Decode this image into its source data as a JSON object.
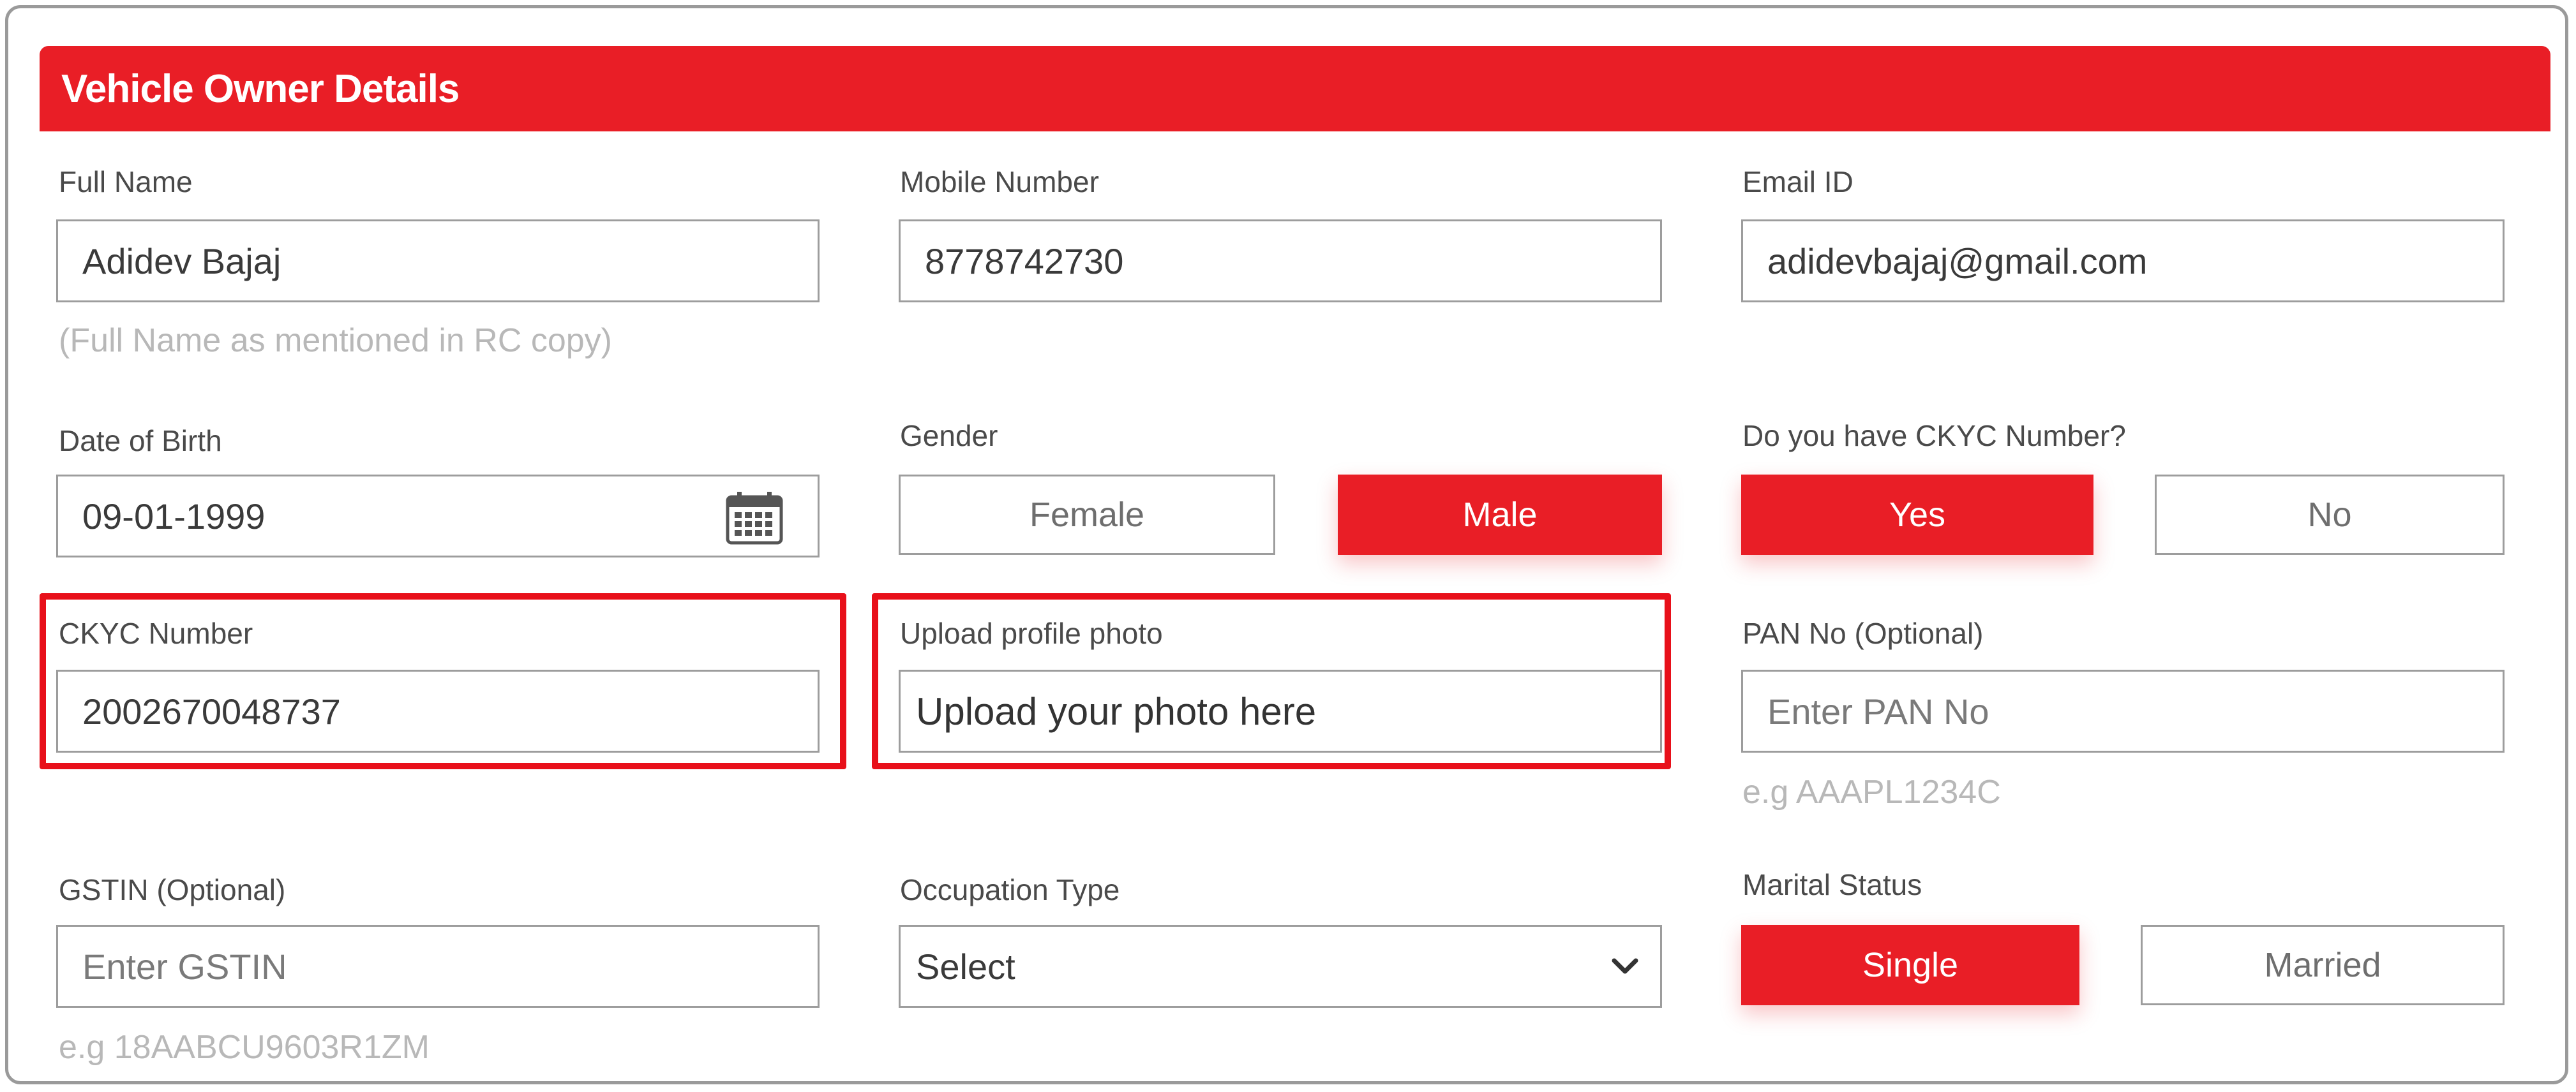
{
  "header": {
    "title": "Vehicle Owner Details"
  },
  "full_name": {
    "label": "Full Name",
    "value": "Adidev Bajaj",
    "hint": "(Full Name as mentioned in RC copy)"
  },
  "mobile": {
    "label": "Mobile Number",
    "value": "8778742730"
  },
  "email": {
    "label": "Email ID",
    "value": "adidevbajaj@gmail.com"
  },
  "dob": {
    "label": "Date of Birth",
    "value": "09-01-1999",
    "icon": "calendar-icon"
  },
  "gender": {
    "label": "Gender",
    "options": [
      "Female",
      "Male"
    ],
    "selected": "Male"
  },
  "ckyc_question": {
    "label": "Do you have CKYC Number?",
    "options": [
      "Yes",
      "No"
    ],
    "selected": "Yes"
  },
  "ckyc_number": {
    "label": "CKYC Number",
    "value": "2002670048737"
  },
  "upload_photo": {
    "label": "Upload profile photo",
    "placeholder": "Upload your photo here"
  },
  "pan": {
    "label": "PAN No (Optional)",
    "placeholder": "Enter PAN No",
    "hint": "e.g AAAPL1234C"
  },
  "gstin": {
    "label": "GSTIN (Optional)",
    "placeholder": "Enter GSTIN",
    "hint": "e.g 18AABCU9603R1ZM"
  },
  "occupation": {
    "label": "Occupation Type",
    "value": "Select",
    "icon": "chevron-down-icon"
  },
  "marital": {
    "label": "Marital Status",
    "options": [
      "Single",
      "Married"
    ],
    "selected": "Single"
  },
  "colors": {
    "accent": "#e91e26",
    "highlight": "#e8101a",
    "border": "#9d9d9d",
    "hint": "#b8b8b8"
  }
}
